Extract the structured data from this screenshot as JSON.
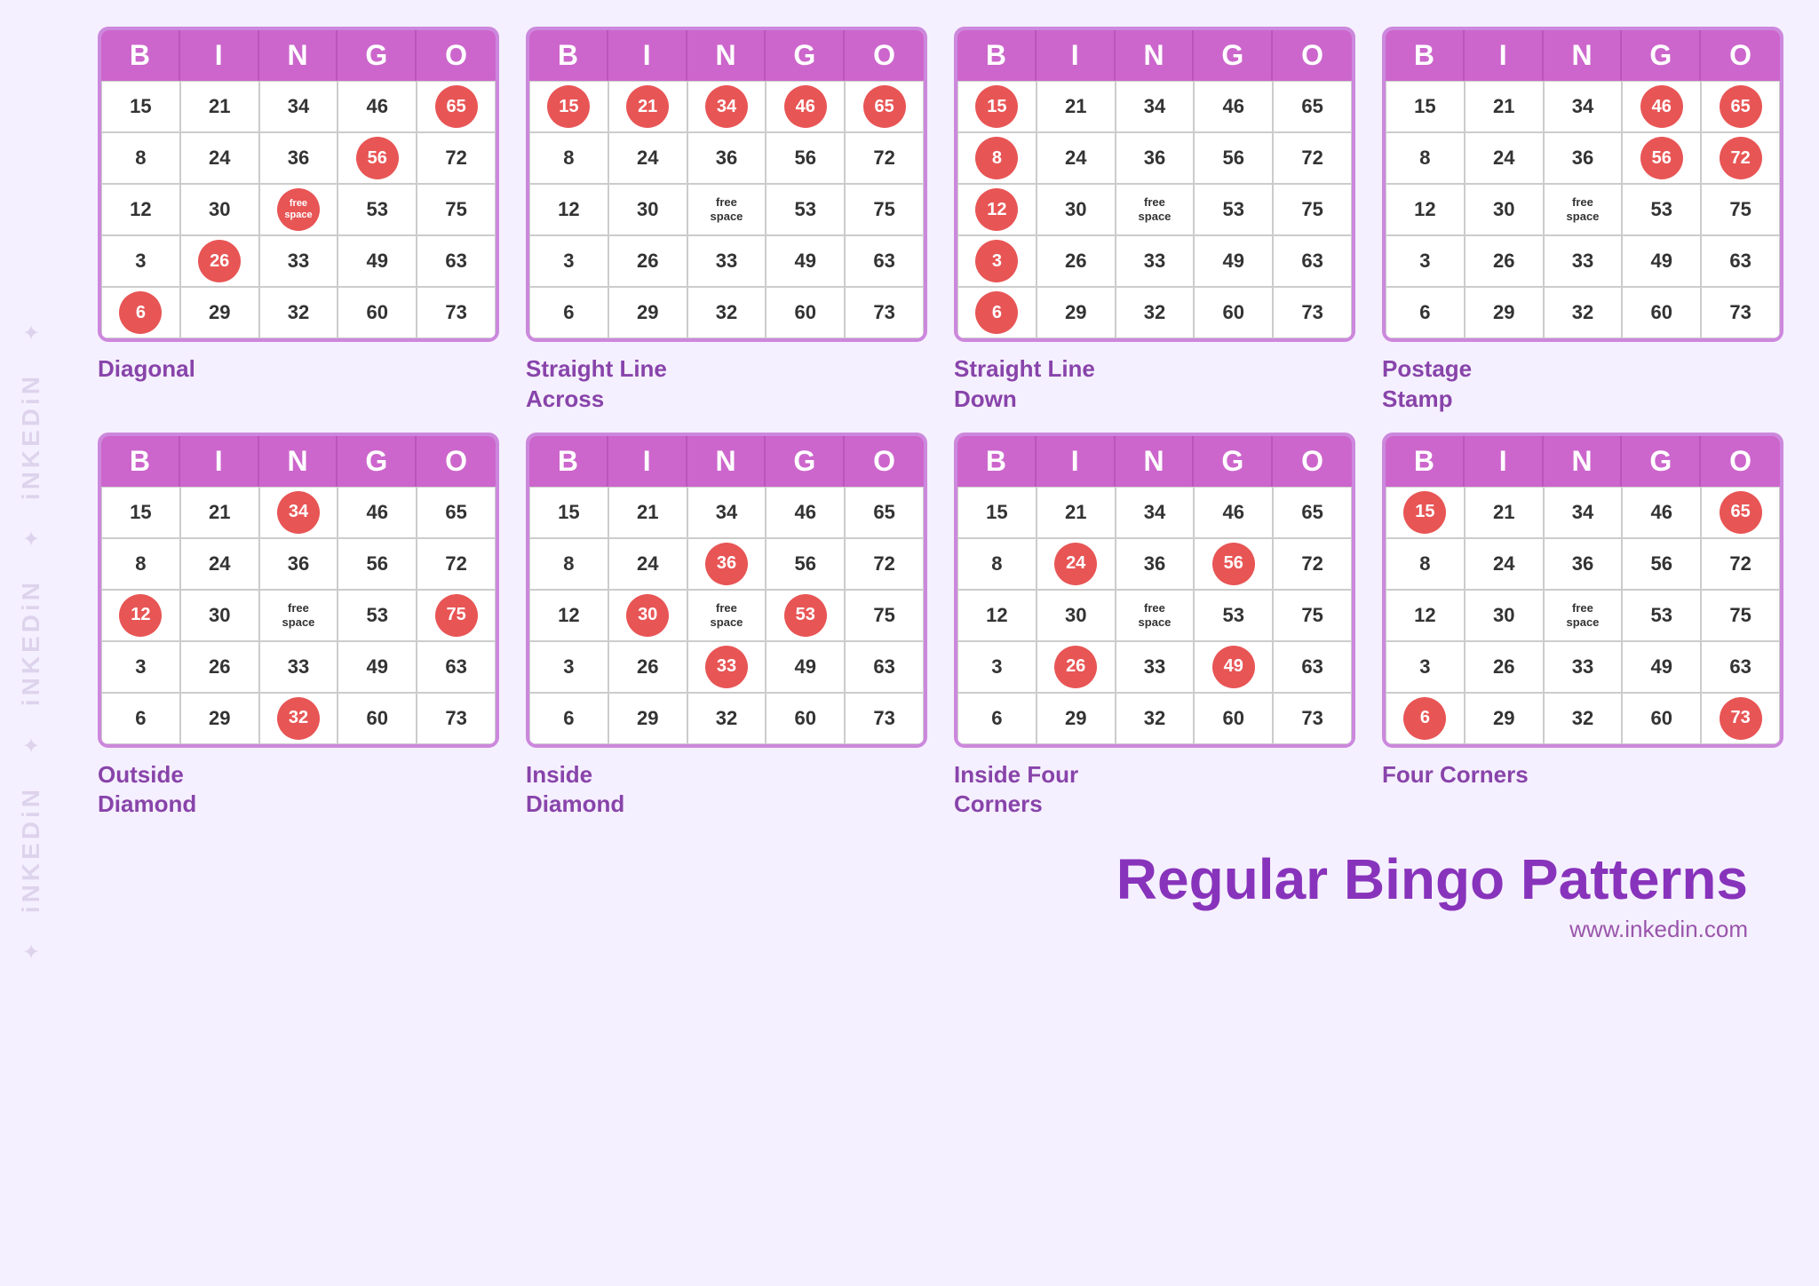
{
  "watermark": {
    "texts": [
      "iNKEDiN",
      "iNKEDiN",
      "iNKEDiN"
    ],
    "icon": "✦"
  },
  "header_letters": [
    "B",
    "I",
    "N",
    "G",
    "O"
  ],
  "cards": [
    {
      "name": "diagonal",
      "label": "Diagonal",
      "rows": [
        [
          {
            "v": "15",
            "m": false
          },
          {
            "v": "21",
            "m": false
          },
          {
            "v": "34",
            "m": false
          },
          {
            "v": "46",
            "m": false
          },
          {
            "v": "65",
            "m": true
          }
        ],
        [
          {
            "v": "8",
            "m": false
          },
          {
            "v": "24",
            "m": false
          },
          {
            "v": "36",
            "m": false
          },
          {
            "v": "56",
            "m": true
          },
          {
            "v": "72",
            "m": false
          }
        ],
        [
          {
            "v": "12",
            "m": false
          },
          {
            "v": "30",
            "m": false
          },
          {
            "v": "free\nspace",
            "m": true,
            "free": true
          },
          {
            "v": "53",
            "m": false
          },
          {
            "v": "75",
            "m": false
          }
        ],
        [
          {
            "v": "3",
            "m": false
          },
          {
            "v": "26",
            "m": true
          },
          {
            "v": "33",
            "m": false
          },
          {
            "v": "49",
            "m": false
          },
          {
            "v": "63",
            "m": false
          }
        ],
        [
          {
            "v": "6",
            "m": true
          },
          {
            "v": "29",
            "m": false
          },
          {
            "v": "32",
            "m": false
          },
          {
            "v": "60",
            "m": false
          },
          {
            "v": "73",
            "m": false
          }
        ]
      ]
    },
    {
      "name": "straight-line-across",
      "label": "Straight Line\nAcross",
      "rows": [
        [
          {
            "v": "15",
            "m": true
          },
          {
            "v": "21",
            "m": true
          },
          {
            "v": "34",
            "m": true
          },
          {
            "v": "46",
            "m": true
          },
          {
            "v": "65",
            "m": true
          }
        ],
        [
          {
            "v": "8",
            "m": false
          },
          {
            "v": "24",
            "m": false
          },
          {
            "v": "36",
            "m": false
          },
          {
            "v": "56",
            "m": false
          },
          {
            "v": "72",
            "m": false
          }
        ],
        [
          {
            "v": "12",
            "m": false
          },
          {
            "v": "30",
            "m": false
          },
          {
            "v": "free\nspace",
            "m": false,
            "free": true
          },
          {
            "v": "53",
            "m": false
          },
          {
            "v": "75",
            "m": false
          }
        ],
        [
          {
            "v": "3",
            "m": false
          },
          {
            "v": "26",
            "m": false
          },
          {
            "v": "33",
            "m": false
          },
          {
            "v": "49",
            "m": false
          },
          {
            "v": "63",
            "m": false
          }
        ],
        [
          {
            "v": "6",
            "m": false
          },
          {
            "v": "29",
            "m": false
          },
          {
            "v": "32",
            "m": false
          },
          {
            "v": "60",
            "m": false
          },
          {
            "v": "73",
            "m": false
          }
        ]
      ]
    },
    {
      "name": "straight-line-down",
      "label": "Straight Line\nDown",
      "rows": [
        [
          {
            "v": "15",
            "m": true
          },
          {
            "v": "21",
            "m": false
          },
          {
            "v": "34",
            "m": false
          },
          {
            "v": "46",
            "m": false
          },
          {
            "v": "65",
            "m": false
          }
        ],
        [
          {
            "v": "8",
            "m": true
          },
          {
            "v": "24",
            "m": false
          },
          {
            "v": "36",
            "m": false
          },
          {
            "v": "56",
            "m": false
          },
          {
            "v": "72",
            "m": false
          }
        ],
        [
          {
            "v": "12",
            "m": true
          },
          {
            "v": "30",
            "m": false
          },
          {
            "v": "free\nspace",
            "m": false,
            "free": true
          },
          {
            "v": "53",
            "m": false
          },
          {
            "v": "75",
            "m": false
          }
        ],
        [
          {
            "v": "3",
            "m": true
          },
          {
            "v": "26",
            "m": false
          },
          {
            "v": "33",
            "m": false
          },
          {
            "v": "49",
            "m": false
          },
          {
            "v": "63",
            "m": false
          }
        ],
        [
          {
            "v": "6",
            "m": true
          },
          {
            "v": "29",
            "m": false
          },
          {
            "v": "32",
            "m": false
          },
          {
            "v": "60",
            "m": false
          },
          {
            "v": "73",
            "m": false
          }
        ]
      ]
    },
    {
      "name": "postage-stamp",
      "label": "Postage\nStamp",
      "rows": [
        [
          {
            "v": "15",
            "m": false
          },
          {
            "v": "21",
            "m": false
          },
          {
            "v": "34",
            "m": false
          },
          {
            "v": "46",
            "m": true
          },
          {
            "v": "65",
            "m": true
          }
        ],
        [
          {
            "v": "8",
            "m": false
          },
          {
            "v": "24",
            "m": false
          },
          {
            "v": "36",
            "m": false
          },
          {
            "v": "56",
            "m": true
          },
          {
            "v": "72",
            "m": true
          }
        ],
        [
          {
            "v": "12",
            "m": false
          },
          {
            "v": "30",
            "m": false
          },
          {
            "v": "free\nspace",
            "m": false,
            "free": true
          },
          {
            "v": "53",
            "m": false
          },
          {
            "v": "75",
            "m": false
          }
        ],
        [
          {
            "v": "3",
            "m": false
          },
          {
            "v": "26",
            "m": false
          },
          {
            "v": "33",
            "m": false
          },
          {
            "v": "49",
            "m": false
          },
          {
            "v": "63",
            "m": false
          }
        ],
        [
          {
            "v": "6",
            "m": false
          },
          {
            "v": "29",
            "m": false
          },
          {
            "v": "32",
            "m": false
          },
          {
            "v": "60",
            "m": false
          },
          {
            "v": "73",
            "m": false
          }
        ]
      ]
    },
    {
      "name": "outside-diamond",
      "label": "Outside\nDiamond",
      "rows": [
        [
          {
            "v": "15",
            "m": false
          },
          {
            "v": "21",
            "m": false
          },
          {
            "v": "34",
            "m": true
          },
          {
            "v": "46",
            "m": false
          },
          {
            "v": "65",
            "m": false
          }
        ],
        [
          {
            "v": "8",
            "m": false
          },
          {
            "v": "24",
            "m": false
          },
          {
            "v": "36",
            "m": false
          },
          {
            "v": "56",
            "m": false
          },
          {
            "v": "72",
            "m": false
          }
        ],
        [
          {
            "v": "12",
            "m": true
          },
          {
            "v": "30",
            "m": false
          },
          {
            "v": "free\nspace",
            "m": false,
            "free": true
          },
          {
            "v": "53",
            "m": false
          },
          {
            "v": "75",
            "m": true
          }
        ],
        [
          {
            "v": "3",
            "m": false
          },
          {
            "v": "26",
            "m": false
          },
          {
            "v": "33",
            "m": false
          },
          {
            "v": "49",
            "m": false
          },
          {
            "v": "63",
            "m": false
          }
        ],
        [
          {
            "v": "6",
            "m": false
          },
          {
            "v": "29",
            "m": false
          },
          {
            "v": "32",
            "m": true
          },
          {
            "v": "60",
            "m": false
          },
          {
            "v": "73",
            "m": false
          }
        ]
      ]
    },
    {
      "name": "inside-diamond",
      "label": "Inside\nDiamond",
      "rows": [
        [
          {
            "v": "15",
            "m": false
          },
          {
            "v": "21",
            "m": false
          },
          {
            "v": "34",
            "m": false
          },
          {
            "v": "46",
            "m": false
          },
          {
            "v": "65",
            "m": false
          }
        ],
        [
          {
            "v": "8",
            "m": false
          },
          {
            "v": "24",
            "m": false
          },
          {
            "v": "36",
            "m": true
          },
          {
            "v": "56",
            "m": false
          },
          {
            "v": "72",
            "m": false
          }
        ],
        [
          {
            "v": "12",
            "m": false
          },
          {
            "v": "30",
            "m": true
          },
          {
            "v": "free\nspace",
            "m": false,
            "free": true
          },
          {
            "v": "53",
            "m": true
          },
          {
            "v": "75",
            "m": false
          }
        ],
        [
          {
            "v": "3",
            "m": false
          },
          {
            "v": "26",
            "m": false
          },
          {
            "v": "33",
            "m": true
          },
          {
            "v": "49",
            "m": false
          },
          {
            "v": "63",
            "m": false
          }
        ],
        [
          {
            "v": "6",
            "m": false
          },
          {
            "v": "29",
            "m": false
          },
          {
            "v": "32",
            "m": false
          },
          {
            "v": "60",
            "m": false
          },
          {
            "v": "73",
            "m": false
          }
        ]
      ]
    },
    {
      "name": "inside-four-corners",
      "label": "Inside Four\nCorners",
      "rows": [
        [
          {
            "v": "15",
            "m": false
          },
          {
            "v": "21",
            "m": false
          },
          {
            "v": "34",
            "m": false
          },
          {
            "v": "46",
            "m": false
          },
          {
            "v": "65",
            "m": false
          }
        ],
        [
          {
            "v": "8",
            "m": false
          },
          {
            "v": "24",
            "m": true
          },
          {
            "v": "36",
            "m": false
          },
          {
            "v": "56",
            "m": true
          },
          {
            "v": "72",
            "m": false
          }
        ],
        [
          {
            "v": "12",
            "m": false
          },
          {
            "v": "30",
            "m": false
          },
          {
            "v": "free\nspace",
            "m": false,
            "free": true
          },
          {
            "v": "53",
            "m": false
          },
          {
            "v": "75",
            "m": false
          }
        ],
        [
          {
            "v": "3",
            "m": false
          },
          {
            "v": "26",
            "m": true
          },
          {
            "v": "33",
            "m": false
          },
          {
            "v": "49",
            "m": true
          },
          {
            "v": "63",
            "m": false
          }
        ],
        [
          {
            "v": "6",
            "m": false
          },
          {
            "v": "29",
            "m": false
          },
          {
            "v": "32",
            "m": false
          },
          {
            "v": "60",
            "m": false
          },
          {
            "v": "73",
            "m": false
          }
        ]
      ]
    },
    {
      "name": "four-corners",
      "label": "Four Corners",
      "rows": [
        [
          {
            "v": "15",
            "m": true
          },
          {
            "v": "21",
            "m": false
          },
          {
            "v": "34",
            "m": false
          },
          {
            "v": "46",
            "m": false
          },
          {
            "v": "65",
            "m": true
          }
        ],
        [
          {
            "v": "8",
            "m": false
          },
          {
            "v": "24",
            "m": false
          },
          {
            "v": "36",
            "m": false
          },
          {
            "v": "56",
            "m": false
          },
          {
            "v": "72",
            "m": false
          }
        ],
        [
          {
            "v": "12",
            "m": false
          },
          {
            "v": "30",
            "m": false
          },
          {
            "v": "free\nspace",
            "m": false,
            "free": true
          },
          {
            "v": "53",
            "m": false
          },
          {
            "v": "75",
            "m": false
          }
        ],
        [
          {
            "v": "3",
            "m": false
          },
          {
            "v": "26",
            "m": false
          },
          {
            "v": "33",
            "m": false
          },
          {
            "v": "49",
            "m": false
          },
          {
            "v": "63",
            "m": false
          }
        ],
        [
          {
            "v": "6",
            "m": true
          },
          {
            "v": "29",
            "m": false
          },
          {
            "v": "32",
            "m": false
          },
          {
            "v": "60",
            "m": false
          },
          {
            "v": "73",
            "m": true
          }
        ]
      ]
    }
  ],
  "footer": {
    "title": "Regular Bingo Patterns",
    "url": "www.inkedin.com"
  }
}
